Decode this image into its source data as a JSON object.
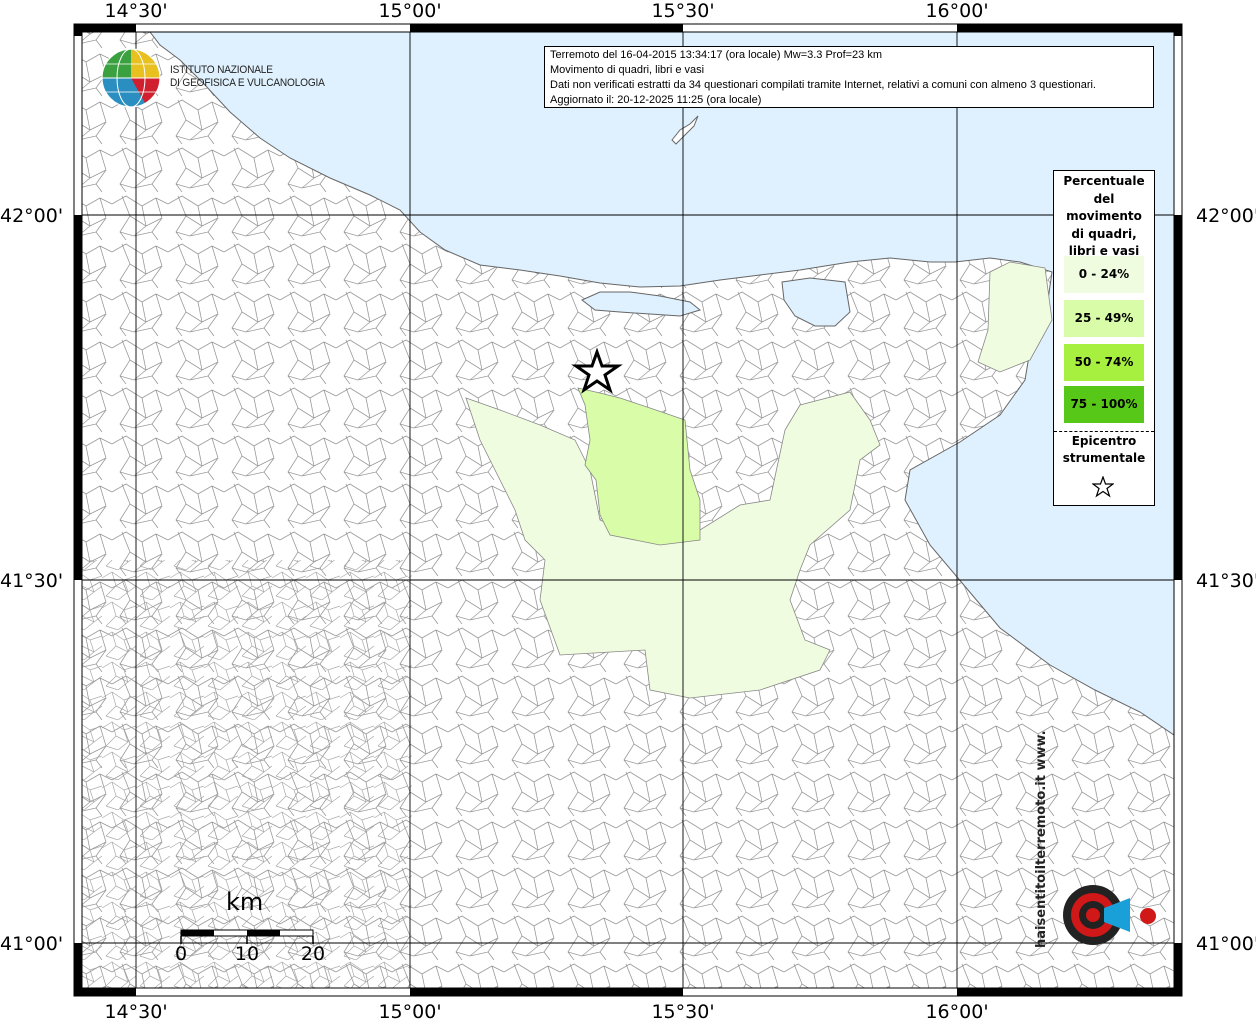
{
  "ticks": {
    "longitudes": [
      "14°30'",
      "15°00'",
      "15°30'",
      "16°00'"
    ],
    "latitudes": [
      "42°00'",
      "41°30'",
      "41°00'"
    ]
  },
  "info": {
    "line1": "Terremoto del 16-04-2015 13:34:17 (ora locale) Mw=3.3 Prof=23 km",
    "line2": "Movimento di quadri, libri e vasi",
    "line3": "Dati non verificati estratti da 34 questionari compilati tramite Internet, relativi a comuni con almeno 3 questionari.",
    "line4": "Aggiornato il: 20-12-2025 11:25 (ora locale)"
  },
  "logo": {
    "line1": "ISTITUTO NAZIONALE",
    "line2": "DI GEOFISICA E VULCANOLOGIA",
    "watermark": "haisentitoilterremoto.it www."
  },
  "legend": {
    "title": [
      "Percentuale",
      "del",
      "movimento",
      "di quadri,",
      "libri e vasi"
    ],
    "classes": [
      {
        "label": "0 - 24%",
        "color": "#f0fce0"
      },
      {
        "label": "25 - 49%",
        "color": "#d8fca8"
      },
      {
        "label": "50 - 74%",
        "color": "#a8f040"
      },
      {
        "label": "75 - 100%",
        "color": "#58c818"
      }
    ],
    "epicenter": [
      "Epicentro",
      "strumentale"
    ]
  },
  "scale": {
    "unit": "km",
    "labels": [
      "0",
      "10",
      "20"
    ]
  },
  "colors": {
    "sea": "#dff1fe",
    "land": "#ffffff",
    "class1": "#f0fce0",
    "class2": "#d8fca8"
  }
}
